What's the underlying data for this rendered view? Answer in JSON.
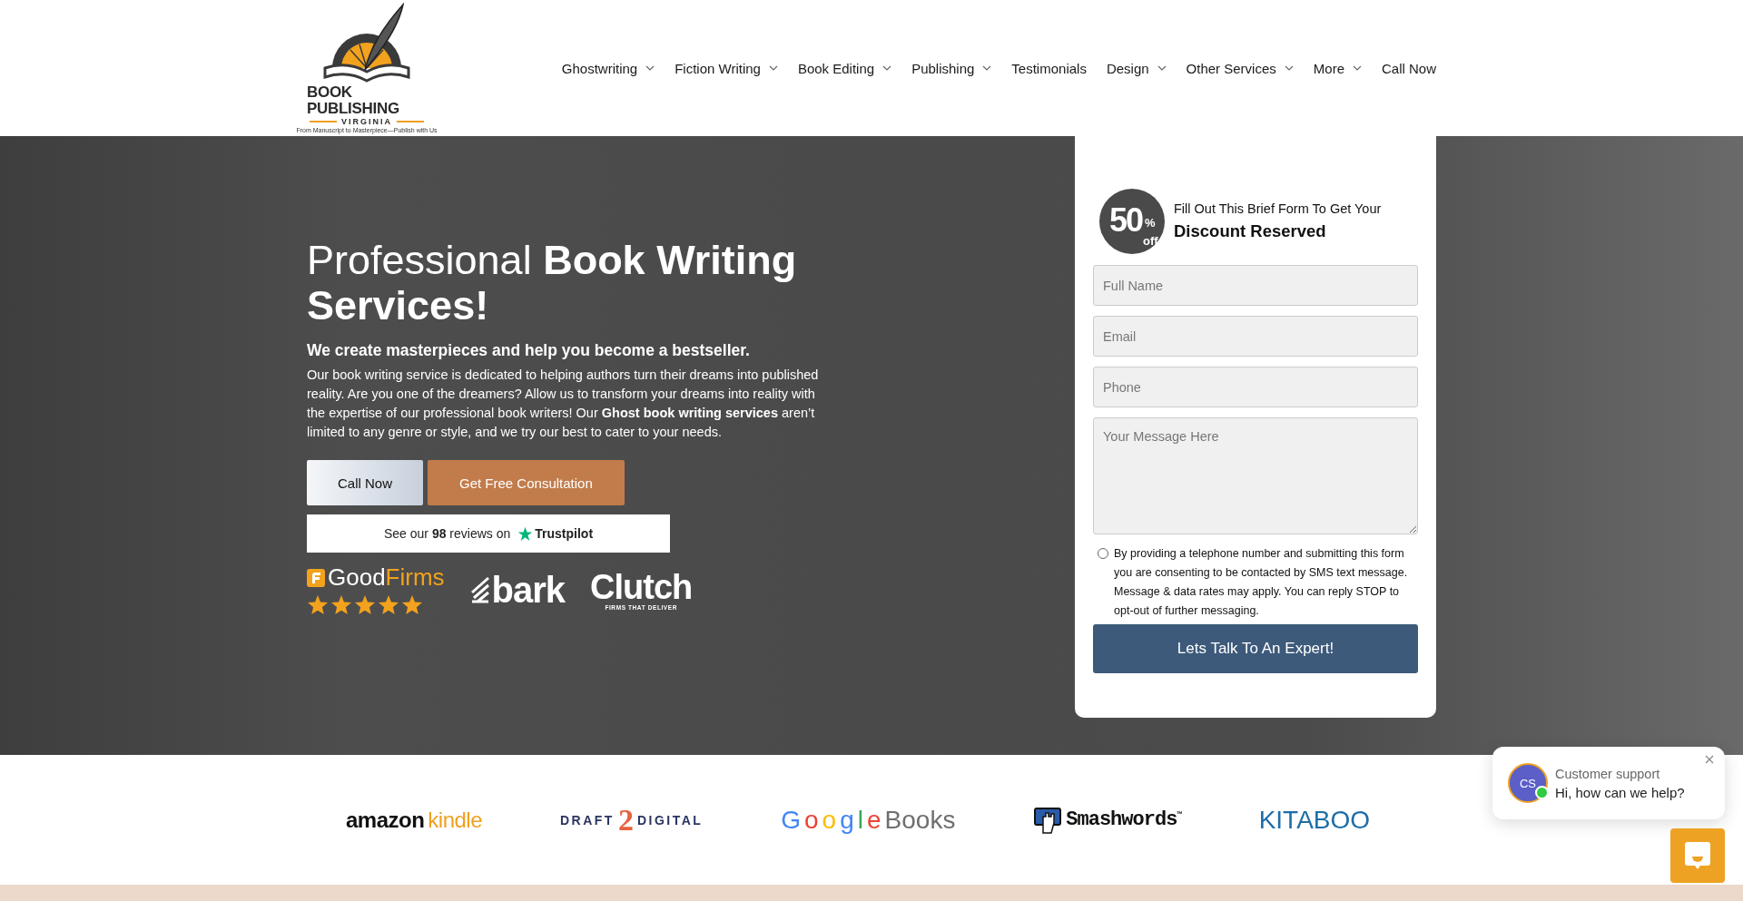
{
  "header": {
    "logo": {
      "title": "BOOK PUBLISHING",
      "subtitle": "VIRGINIA",
      "tagline": "From Manuscript to Masterpiece—Publish with Us"
    },
    "nav": [
      {
        "label": "Ghostwriting",
        "has_menu": true
      },
      {
        "label": "Fiction Writing",
        "has_menu": true
      },
      {
        "label": "Book Editing",
        "has_menu": true
      },
      {
        "label": "Publishing",
        "has_menu": true
      },
      {
        "label": "Testimonials",
        "has_menu": false
      },
      {
        "label": "Design",
        "has_menu": true
      },
      {
        "label": "Other Services",
        "has_menu": true
      },
      {
        "label": "More",
        "has_menu": true
      },
      {
        "label": "Call Now",
        "has_menu": false
      }
    ]
  },
  "hero": {
    "heading": "Professional **Book Writing Services!**",
    "subheading": "We create masterpieces and help you become a bestseller.",
    "body": "Our book writing service is dedicated to helping authors turn their dreams into published reality. Are you one of the dreamers? Allow us to transform your dreams into reality with the expertise of our professional book writers! Our **Ghost book writing services** aren’t limited to any genre or style, and we try our best to cater to your needs.",
    "buttons": [
      {
        "label": "Call Now",
        "kind": "light"
      },
      {
        "label": "Get Free Consultation",
        "kind": "accent"
      }
    ],
    "trustpilot": {
      "text": "See our **98** reviews on",
      "brand": "Trustpilot"
    },
    "badges": [
      {
        "kind": "goodfirms",
        "parts": [
          "Good",
          "Firms"
        ],
        "stars": 5
      },
      {
        "kind": "bark",
        "parts": [
          "bark"
        ]
      },
      {
        "kind": "clutch",
        "parts": [
          "Clutch",
          "FIRMS THAT DELIVER"
        ]
      }
    ]
  },
  "form": {
    "badge": {
      "number": "50",
      "percent": "%",
      "off": "off"
    },
    "intro": "Fill Out This Brief Form To Get Your",
    "title": "Discount Reserved",
    "fields": [
      {
        "placeholder": "Full Name",
        "kind": "input"
      },
      {
        "placeholder": "Email",
        "kind": "input"
      },
      {
        "placeholder": "Phone",
        "kind": "input"
      },
      {
        "placeholder": "Your Message Here",
        "kind": "textarea"
      }
    ],
    "consent": {
      "checked": false,
      "text": "By providing a telephone number and submitting this form you are consenting to be contacted by SMS text message. Message & data rates may apply. You can reply STOP to opt-out of further messaging."
    },
    "submit": "Lets Talk To An Expert!"
  },
  "partners": [
    {
      "kind": "amazon",
      "parts": [
        "amazon",
        "kindle"
      ]
    },
    {
      "kind": "draft2digital",
      "parts": [
        "DRAFT",
        "2",
        "DIGITAL"
      ]
    },
    {
      "kind": "google",
      "parts": [
        "Google",
        "Books"
      ]
    },
    {
      "kind": "smashwords",
      "parts": [
        "Smashwords",
        "™"
      ]
    },
    {
      "kind": "kitaboo",
      "parts": [
        "KITABOO"
      ]
    }
  ],
  "chat": {
    "avatar": "CS",
    "online": true,
    "title": "Customer support",
    "message": "Hi, how can we help?"
  }
}
